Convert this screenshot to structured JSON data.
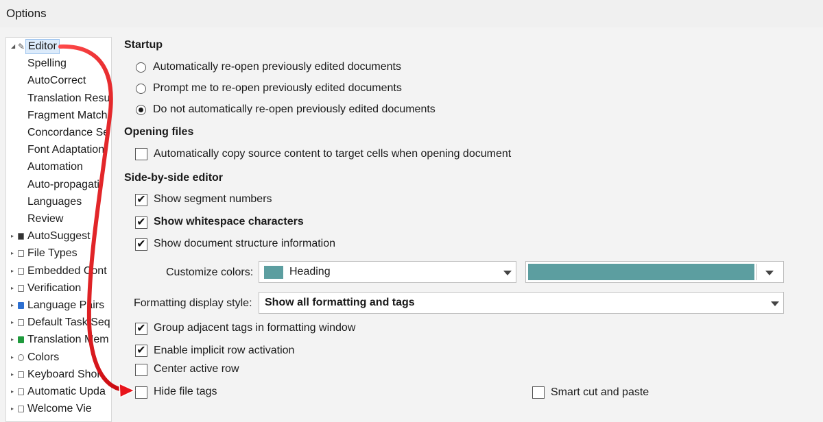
{
  "window": {
    "title": "Options"
  },
  "tree": {
    "items": [
      {
        "label": "Editor",
        "expander": "◢",
        "icon": "pencil-icon"
      },
      {
        "label": "Spelling"
      },
      {
        "label": "AutoCorrect"
      },
      {
        "label": "Translation Resu"
      },
      {
        "label": "Fragment Match"
      },
      {
        "label": "Concordance Se"
      },
      {
        "label": "Font Adaptation"
      },
      {
        "label": "Automation"
      },
      {
        "label": "Auto-propagati"
      },
      {
        "label": "Languages"
      },
      {
        "label": "Review"
      },
      {
        "label": "AutoSuggest",
        "expander": "▸",
        "icon": "autosuggest-icon"
      },
      {
        "label": "File Types",
        "expander": "▸",
        "icon": "file-types-icon"
      },
      {
        "label": "Embedded Cont",
        "expander": "▸",
        "icon": "embedded-content-icon"
      },
      {
        "label": "Verification",
        "expander": "▸",
        "icon": "verification-icon"
      },
      {
        "label": "Language Pairs",
        "expander": "▸",
        "icon": "language-pairs-icon"
      },
      {
        "label": "Default Task Seq",
        "expander": "▸",
        "icon": "task-sequence-icon"
      },
      {
        "label": "Translation Mem",
        "expander": "▸",
        "icon": "translation-memory-icon"
      },
      {
        "label": "Colors",
        "expander": "▸",
        "icon": "colors-icon"
      },
      {
        "label": "Keyboard Shor",
        "expander": "▸",
        "icon": "keyboard-icon"
      },
      {
        "label": "Automatic Upda",
        "expander": "▸",
        "icon": "update-icon"
      },
      {
        "label": "Welcome Vie",
        "expander": "▸",
        "icon": "welcome-icon"
      }
    ]
  },
  "startup": {
    "title": "Startup",
    "options": [
      {
        "label": "Automatically re-open previously edited documents",
        "selected": false
      },
      {
        "label": "Prompt me to re-open previously edited documents",
        "selected": false
      },
      {
        "label": "Do not automatically re-open previously edited documents",
        "selected": true
      }
    ]
  },
  "opening_files": {
    "title": "Opening files",
    "copy_source": {
      "label": "Automatically copy source content to target cells when opening document",
      "checked": false
    }
  },
  "side_by_side": {
    "title": "Side-by-side editor",
    "show_segment_numbers": {
      "label": "Show segment numbers",
      "checked": true
    },
    "show_whitespace": {
      "label": "Show whitespace characters",
      "checked": true
    },
    "show_structure": {
      "label": "Show document structure information",
      "checked": true
    },
    "customize_colors": {
      "label": "Customize colors:",
      "selected": "Heading",
      "color": "#5c9ea0"
    },
    "formatting": {
      "label": "Formatting display style:",
      "selected": "Show all formatting and tags"
    },
    "group_tags": {
      "label": "Group adjacent tags in formatting window",
      "checked": true
    },
    "implicit_row": {
      "label": "Enable implicit row activation",
      "checked": true
    },
    "center_row": {
      "label": "Center active row",
      "checked": false
    },
    "hide_file_tags": {
      "label": "Hide file tags",
      "checked": false
    },
    "smart_cut": {
      "label": "Smart cut and paste",
      "checked": false
    }
  },
  "annotation": {
    "arrow_color": "#e8141b"
  }
}
